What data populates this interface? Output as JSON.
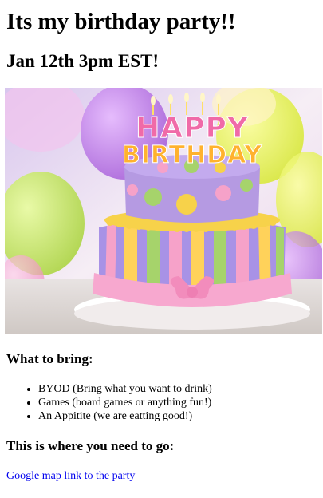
{
  "page": {
    "title": "Its my birthday party!!",
    "subtitle": "Jan 12th 3pm EST!"
  },
  "image": {
    "icon": "birthday-cake-photo",
    "sign_line1": "HAPPY",
    "sign_line2": "BIRTHDAY"
  },
  "bring": {
    "heading": "What to bring:",
    "items": [
      "BYOD (Bring what you want to drink)",
      "Games (board games or anything fun!)",
      "An Appitite (we are eatting good!)"
    ]
  },
  "location": {
    "heading": "This is where you need to go:",
    "link_text": "Google map link to the party"
  },
  "colors": {
    "link": "#0000ee",
    "text": "#000000",
    "background": "#ffffff"
  }
}
